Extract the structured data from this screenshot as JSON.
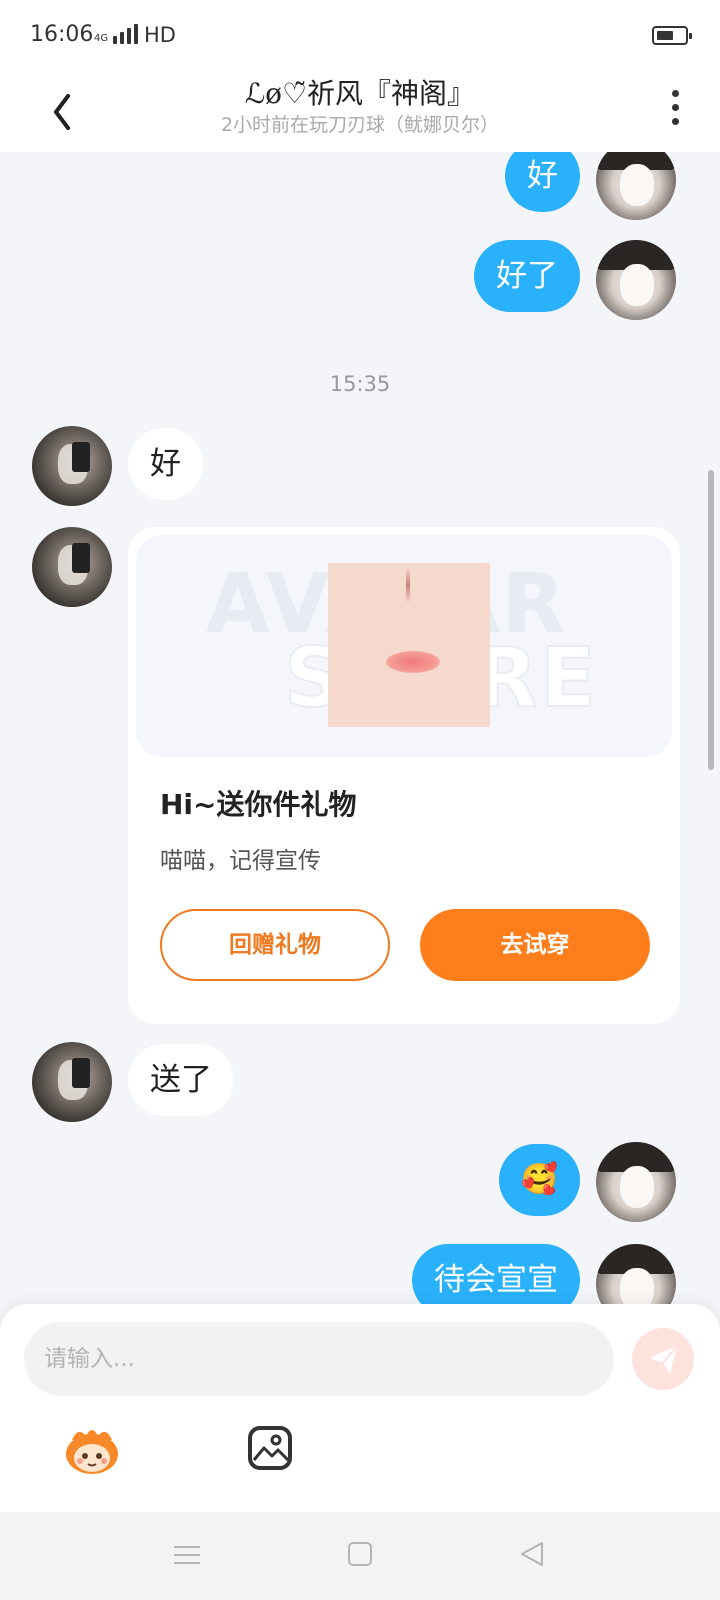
{
  "status_bar": {
    "time": "16:06",
    "network": "4G",
    "hd": "HD",
    "battery_level": 0.6
  },
  "header": {
    "title": "ℒø♡̃祈风『神阁』",
    "subtitle": "2小时前在玩刀刃球（鱿娜贝尔）",
    "icons": [
      "back-icon",
      "more-icon"
    ]
  },
  "chat": {
    "messages": [
      {
        "sender": "me",
        "text": "好"
      },
      {
        "sender": "me",
        "text": "好了"
      },
      {
        "type": "time",
        "text": "15:35"
      },
      {
        "sender": "other",
        "text": "好"
      },
      {
        "sender": "other",
        "type": "gift"
      },
      {
        "sender": "other",
        "text": "送了"
      },
      {
        "sender": "me",
        "emoji": "🥰"
      },
      {
        "sender": "me",
        "text": "待会宣宣"
      }
    ],
    "gift_card": {
      "watermark_line1": "AVATAR",
      "watermark_line2": "STORE",
      "title": "Hi~送你件礼物",
      "description": "喵喵，记得宣传",
      "return_gift_label": "回赠礼物",
      "try_on_label": "去试穿",
      "accent_color": "#fd7e1a"
    }
  },
  "input": {
    "placeholder": "请输入...",
    "value": "",
    "tools": [
      "mascot-avatar-icon",
      "image-icon",
      "send-icon"
    ]
  },
  "colors": {
    "outgoing_bubble": "#29b1fb",
    "incoming_bubble": "#ffffff",
    "background": "#f3f5f8"
  }
}
